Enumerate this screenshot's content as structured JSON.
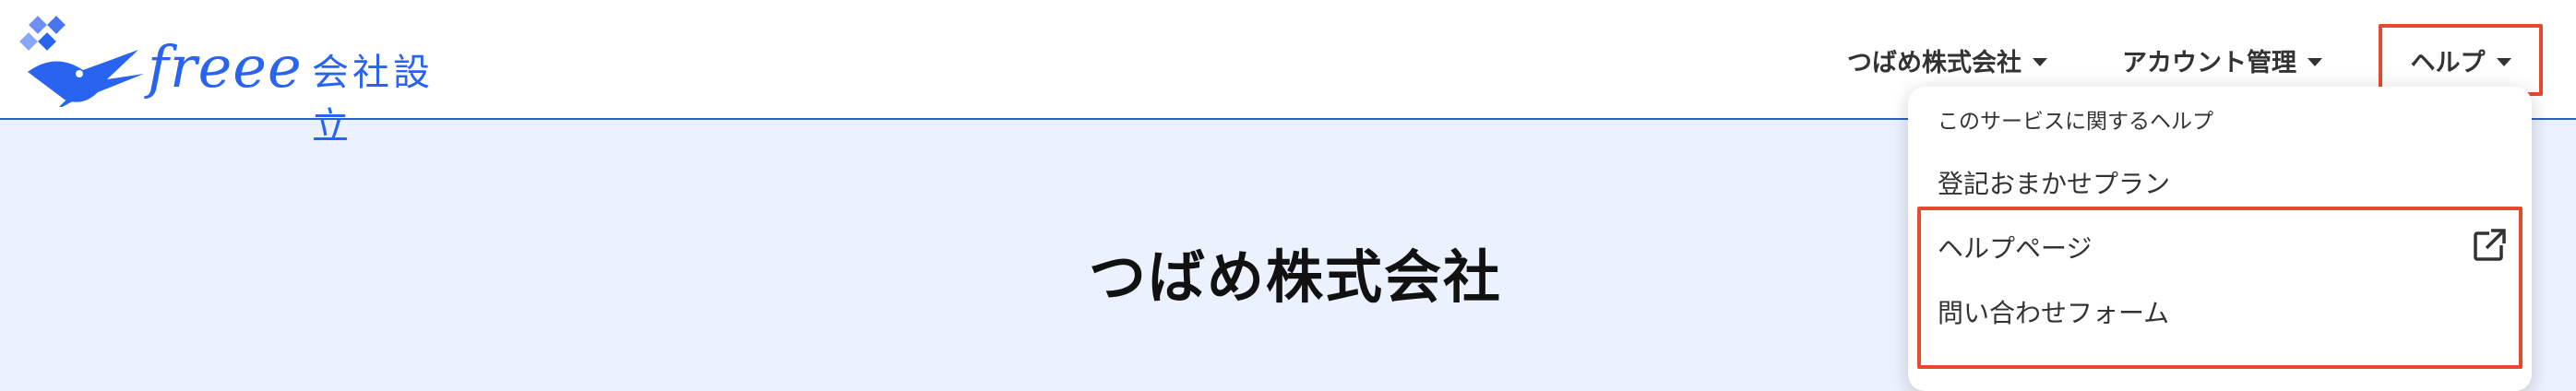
{
  "header": {
    "brand": "freee",
    "brand_suffix": "会社設立",
    "nav": {
      "company": "つばめ株式会社",
      "account": "アカウント管理",
      "help": "ヘルプ"
    }
  },
  "main": {
    "title": "つばめ株式会社"
  },
  "help_menu": {
    "heading": "このサービスに関するヘルプ",
    "items": [
      {
        "label": "登記おまかせプラン"
      },
      {
        "label": "ヘルプページ",
        "icon": "external-link-icon"
      },
      {
        "label": "問い合わせフォーム"
      }
    ]
  },
  "colors": {
    "brand_blue": "#2864f0",
    "header_border": "#2d5fc4",
    "page_background": "#ebf1fd",
    "highlight_red": "#e64a2e"
  }
}
